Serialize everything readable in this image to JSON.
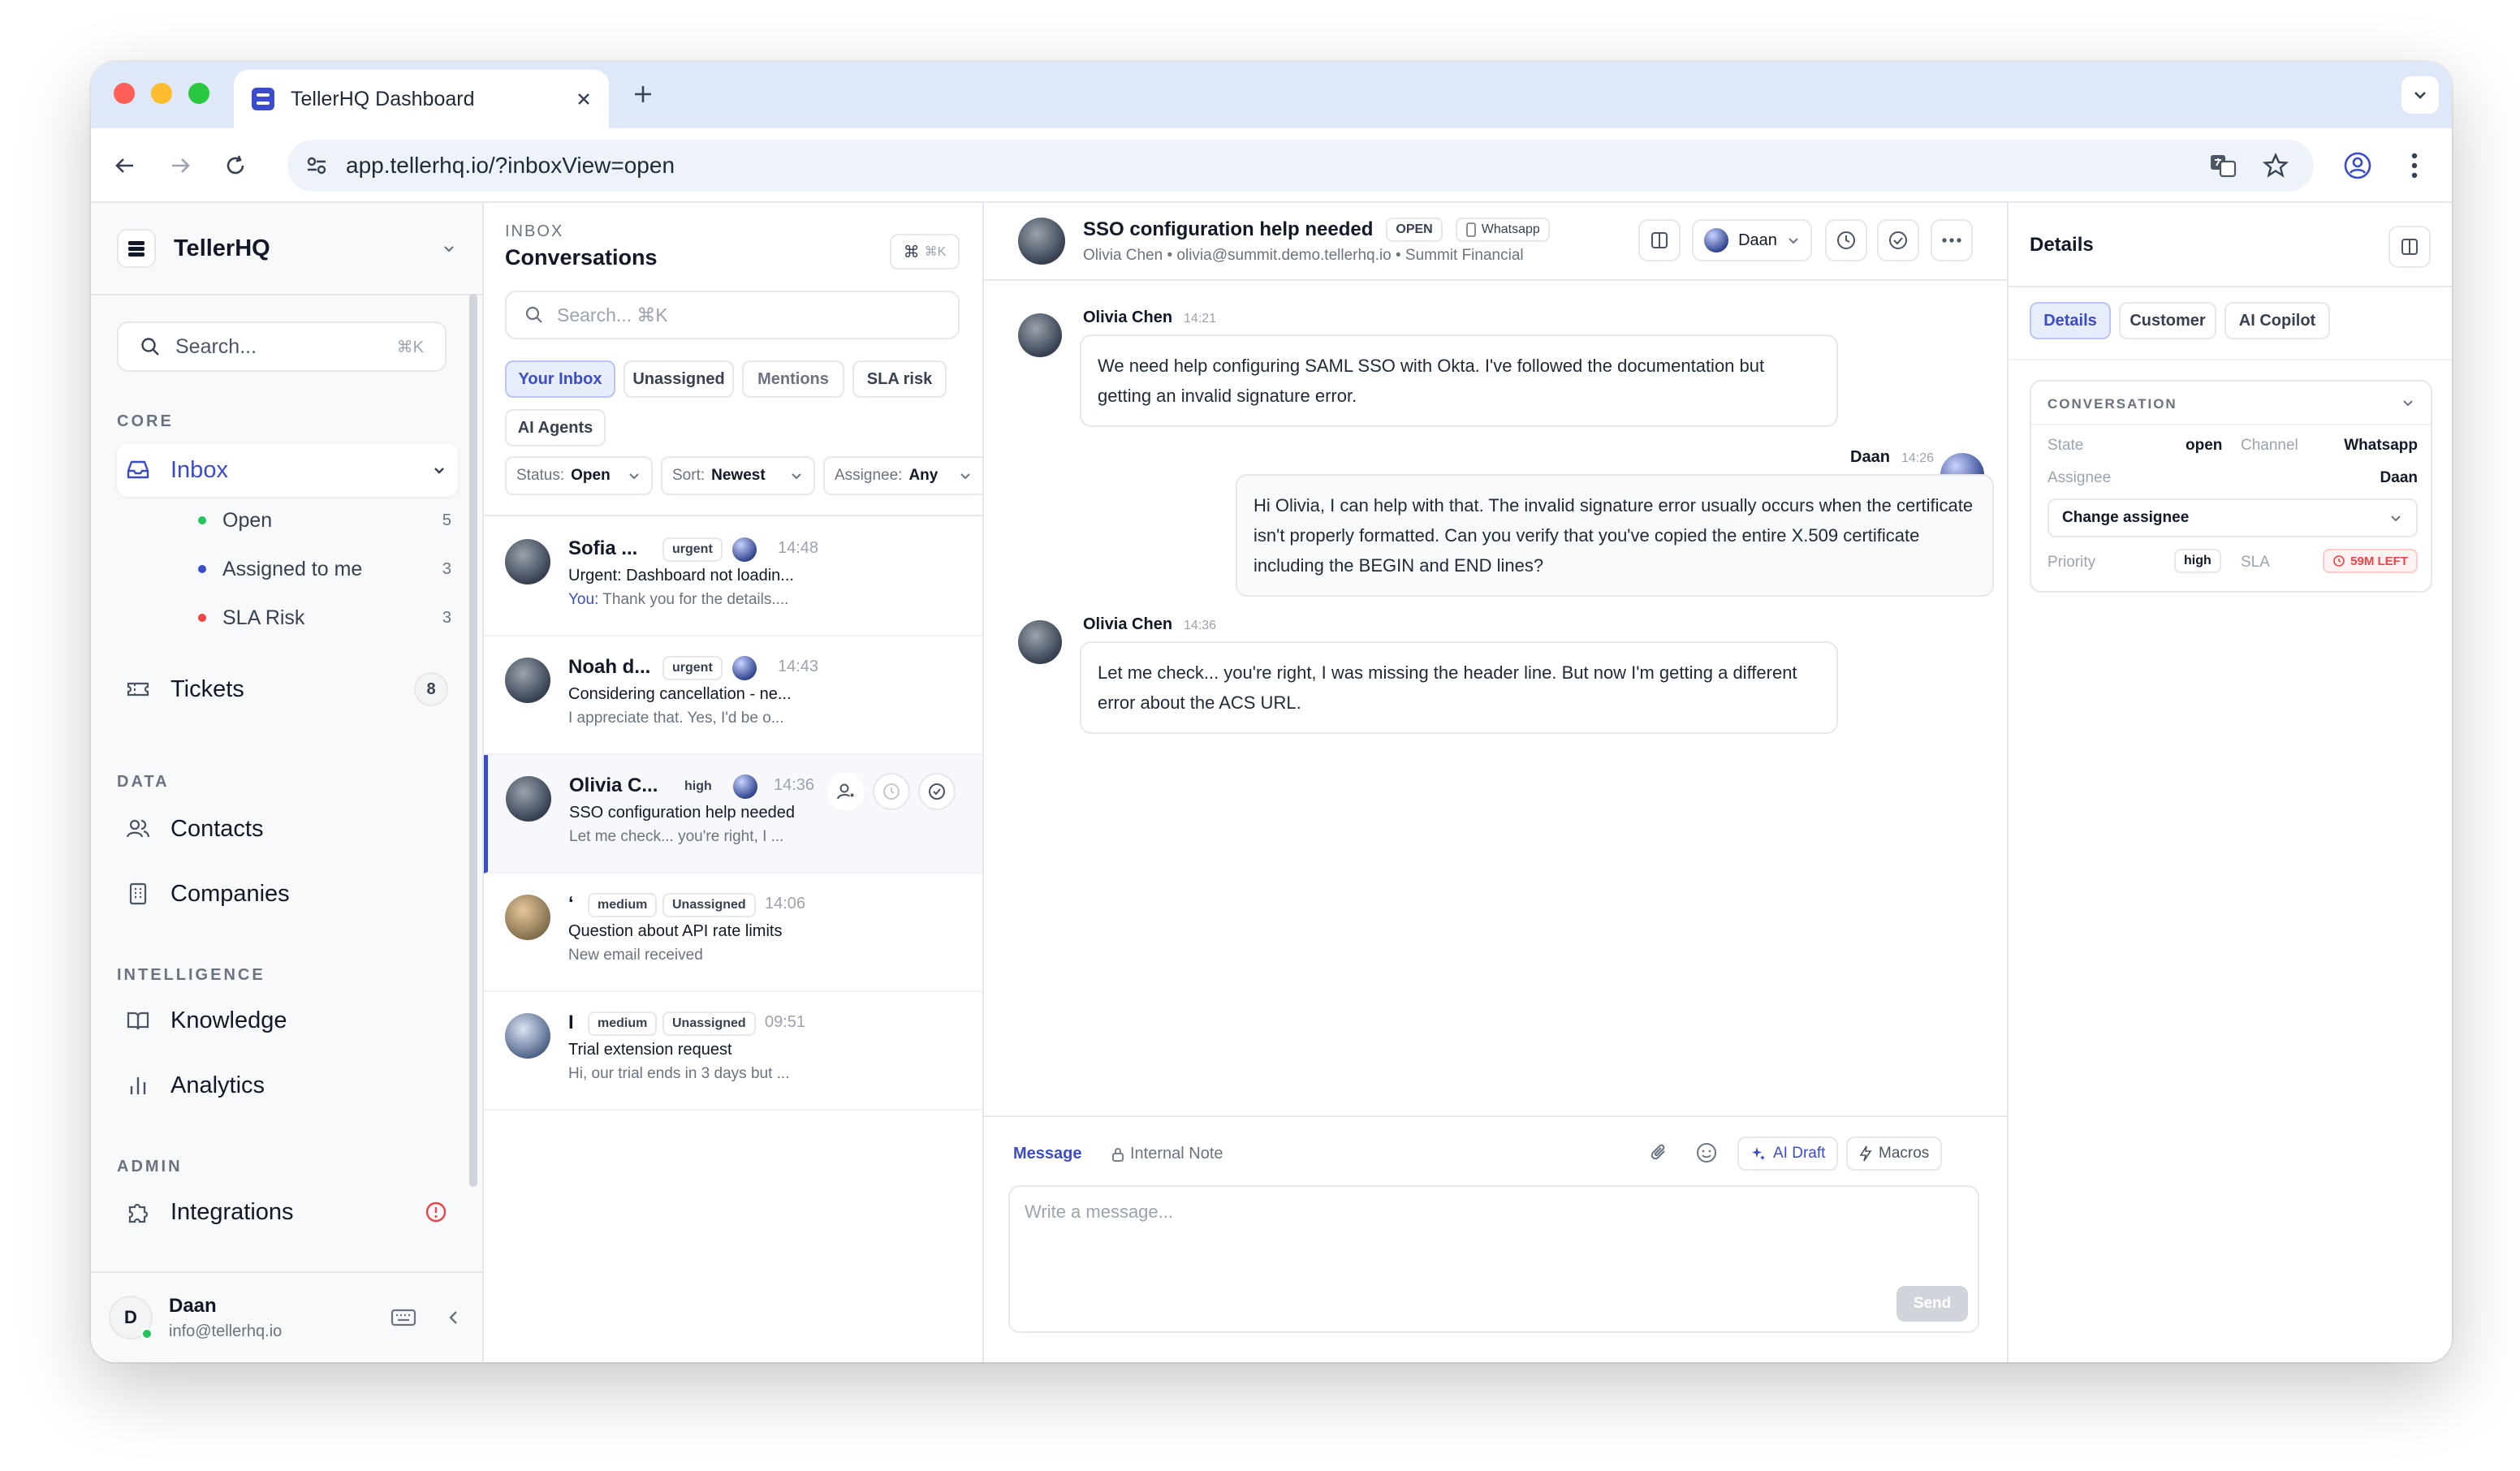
{
  "browser": {
    "tab_title": "TellerHQ Dashboard",
    "url": "app.tellerhq.io/?inboxView=open"
  },
  "sidebar": {
    "brand": "TellerHQ",
    "search_placeholder": "Search...",
    "search_shortcut": "⌘K",
    "sections": {
      "core": "CORE",
      "data": "DATA",
      "intelligence": "INTELLIGENCE",
      "admin": "ADMIN"
    },
    "inbox_label": "Inbox",
    "inbox_sub": [
      {
        "label": "Open",
        "count": "5",
        "color": "#22c55e"
      },
      {
        "label": "Assigned to me",
        "count": "3",
        "color": "#3b4cca"
      },
      {
        "label": "SLA Risk",
        "count": "3",
        "color": "#ef4444"
      }
    ],
    "tickets_label": "Tickets",
    "tickets_count": "8",
    "contacts_label": "Contacts",
    "companies_label": "Companies",
    "knowledge_label": "Knowledge",
    "analytics_label": "Analytics",
    "integrations_label": "Integrations",
    "user": {
      "name": "Daan",
      "email": "info@tellerhq.io",
      "initial": "D"
    }
  },
  "conversations": {
    "eyebrow": "INBOX",
    "title": "Conversations",
    "shortcut": "⌘K",
    "search_placeholder": "Search... ⌘K",
    "filters": [
      "Your Inbox",
      "Unassigned",
      "Mentions",
      "SLA risk",
      "AI Agents"
    ],
    "status_label": "Status:",
    "status_value": "Open",
    "sort_label": "Sort:",
    "sort_value": "Newest",
    "assignee_label": "Assignee:",
    "assignee_value": "Any",
    "items": [
      {
        "name": "Sofia ...",
        "tag": "urgent",
        "time": "14:48",
        "subject": "Urgent: Dashboard not loadin...",
        "preview_prefix": "You:",
        "preview": "Thank you for the details...."
      },
      {
        "name": "Noah d...",
        "tag": "urgent",
        "time": "14:43",
        "subject": "Considering cancellation - ne...",
        "preview_prefix": "",
        "preview": "I appreciate that. Yes, I'd be o..."
      },
      {
        "name": "Olivia C...",
        "tag": "high",
        "time": "14:36",
        "subject": "SSO configuration help needed",
        "preview_prefix": "",
        "preview": "Let me check... you're right, I ..."
      },
      {
        "name": "ʻ",
        "tag": "medium",
        "tag2": "Unassigned",
        "time": "14:06",
        "subject": "Question about API rate limits",
        "preview_prefix": "",
        "preview": "New email received"
      },
      {
        "name": "I",
        "tag": "medium",
        "tag2": "Unassigned",
        "time": "09:51",
        "subject": "Trial extension request",
        "preview_prefix": "",
        "preview": "Hi, our trial ends in 3 days but ..."
      }
    ]
  },
  "thread": {
    "title": "SSO configuration help needed",
    "status": "OPEN",
    "channel": "Whatsapp",
    "meta": "Olivia Chen • olivia@summit.demo.tellerhq.io • Summit Financial",
    "assignee": "Daan",
    "messages": [
      {
        "author": "Olivia Chen",
        "time": "14:21",
        "text": "We need help configuring SAML SSO with Okta. I've followed the documentation but getting an invalid signature error."
      },
      {
        "author": "Daan",
        "time": "14:26",
        "text": "Hi Olivia, I can help with that. The invalid signature error usually occurs when the certificate isn't properly formatted. Can you verify that you've copied the entire X.509 certificate including the BEGIN and END lines?"
      },
      {
        "author": "Olivia Chen",
        "time": "14:36",
        "text": "Let me check... you're right, I was missing the header line. But now I'm getting a different error about the ACS URL."
      }
    ],
    "composer": {
      "tab_message": "Message",
      "tab_note": "Internal Note",
      "ai_draft": "AI Draft",
      "macros": "Macros",
      "placeholder": "Write a message...",
      "send": "Send"
    }
  },
  "details": {
    "title": "Details",
    "tabs": [
      "Details",
      "Customer",
      "AI Copilot"
    ],
    "section": "CONVERSATION",
    "state_label": "State",
    "state_value": "open",
    "channel_label": "Channel",
    "channel_value": "Whatsapp",
    "assignee_label": "Assignee",
    "assignee_value": "Daan",
    "change_assignee": "Change assignee",
    "priority_label": "Priority",
    "priority_value": "high",
    "sla_label": "SLA",
    "sla_value": "59M LEFT"
  },
  "colors": {
    "accent": "#3b4cca",
    "danger": "#ef4444",
    "success": "#22c55e"
  }
}
